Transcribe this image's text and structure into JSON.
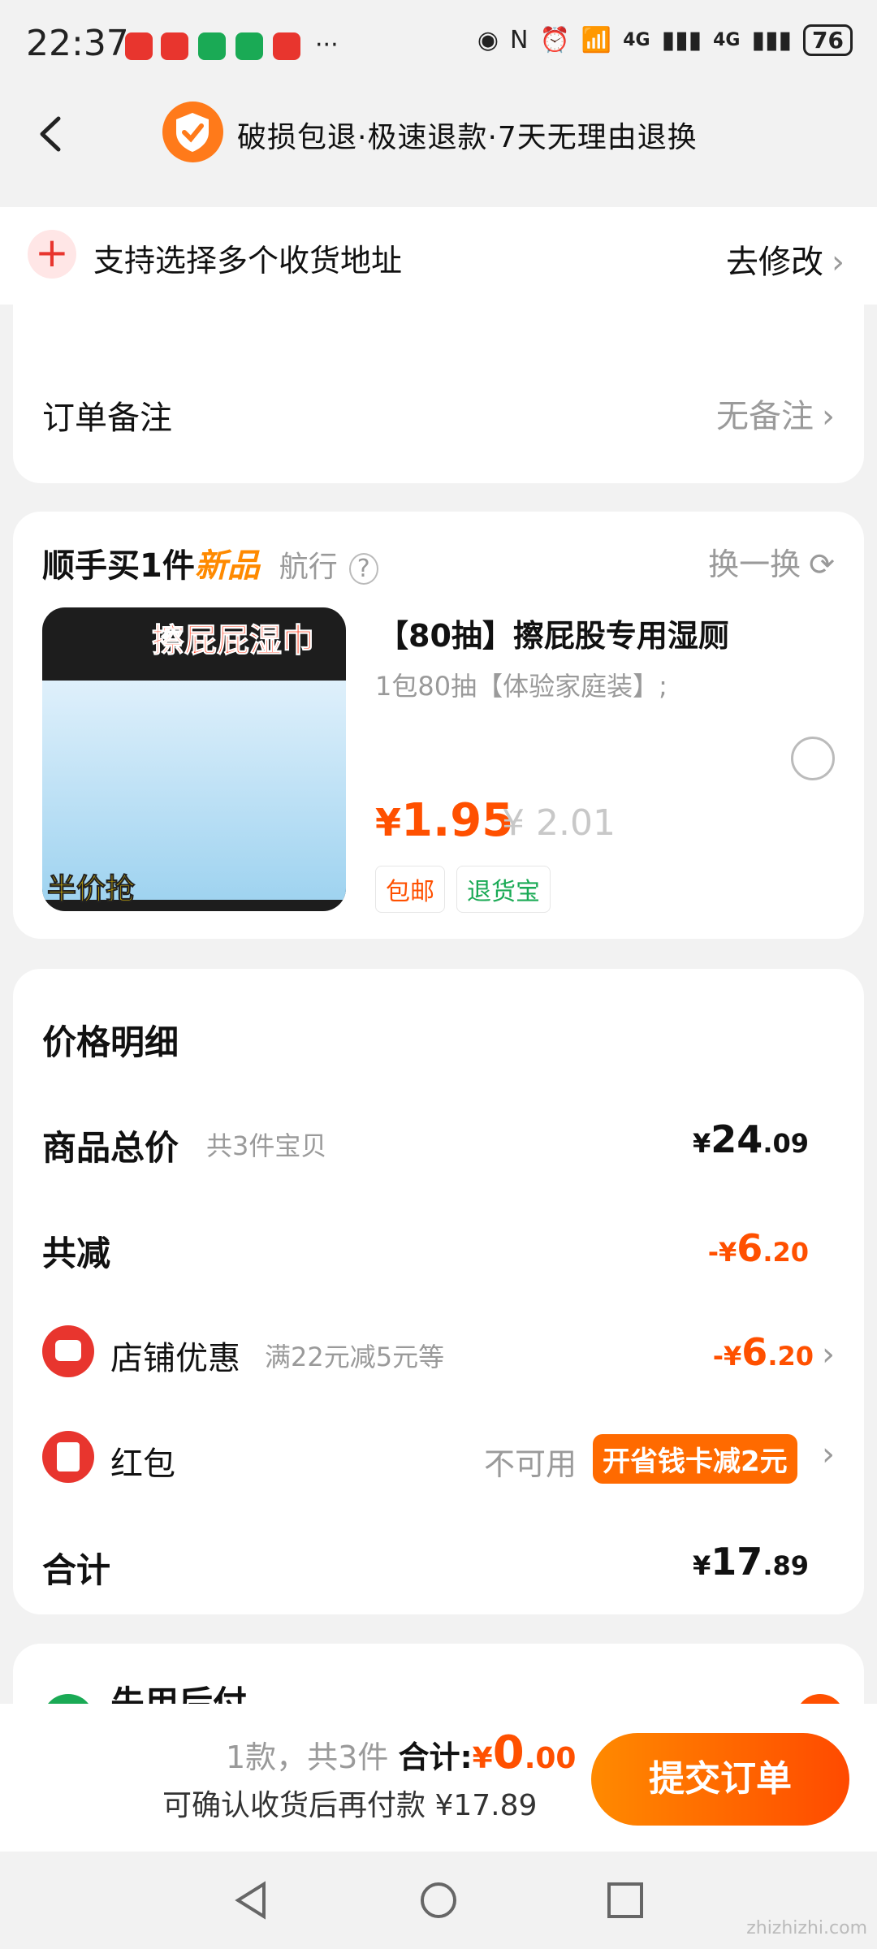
{
  "status": {
    "time": "22:37",
    "battery": "76",
    "network": "4G",
    "ellipsis": "···"
  },
  "header": {
    "guarantee_text": "破损包退·极速退款·7天无理由退换"
  },
  "address_bar": {
    "text": "支持选择多个收货地址",
    "action": "去修改",
    "chevron": "›"
  },
  "order_note": {
    "label": "订单备注",
    "value": "无备注"
  },
  "add_on": {
    "title_prefix": "顺手买1件",
    "title_tag": "新品",
    "brand": "航行",
    "switch_label": "换一换",
    "product": {
      "image_overlay_top": "擦屁屁湿巾",
      "image_overlay_bottom": "半价抢",
      "name": "【80抽】擦屁股专用湿厕",
      "spec": "1包80抽【体验家庭装】;",
      "price_symbol": "¥",
      "price": "1.95",
      "original_price": "¥ 2.01",
      "tags": [
        "包邮",
        "退货宝"
      ]
    }
  },
  "price_detail": {
    "title": "价格明细",
    "total_label": "商品总价",
    "total_count": "共3件宝贝",
    "total_symbol": "¥",
    "total_int": "24",
    "total_dec": ".09",
    "reduce_label": "共减",
    "reduce_prefix": "-¥",
    "reduce_int": "6",
    "reduce_dec": ".20",
    "shop_label": "店铺优惠",
    "shop_desc": "满22元减5元等",
    "shop_int": "6",
    "shop_dec": ".20",
    "redpacket_label": "红包",
    "redpacket_status": "不可用",
    "redpacket_promo": "开省钱卡减2元",
    "sum_label": "合计",
    "sum_int": "17",
    "sum_dec": ".89"
  },
  "pay_later": {
    "title": "先用后付"
  },
  "bottom_bar": {
    "count_text": "1款，共3件",
    "total_label": "合计:",
    "symbol": "¥",
    "total_int": "0",
    "total_dec": ".00",
    "sub_text": "可确认收货后再付款 ¥17.89",
    "submit_label": "提交订单"
  },
  "watermark": "zhizhizhi.com",
  "colors": {
    "accent": "#ff5000",
    "brand_orange": "#ff7a1a",
    "red": "#e8352e",
    "green": "#1aaa55"
  }
}
